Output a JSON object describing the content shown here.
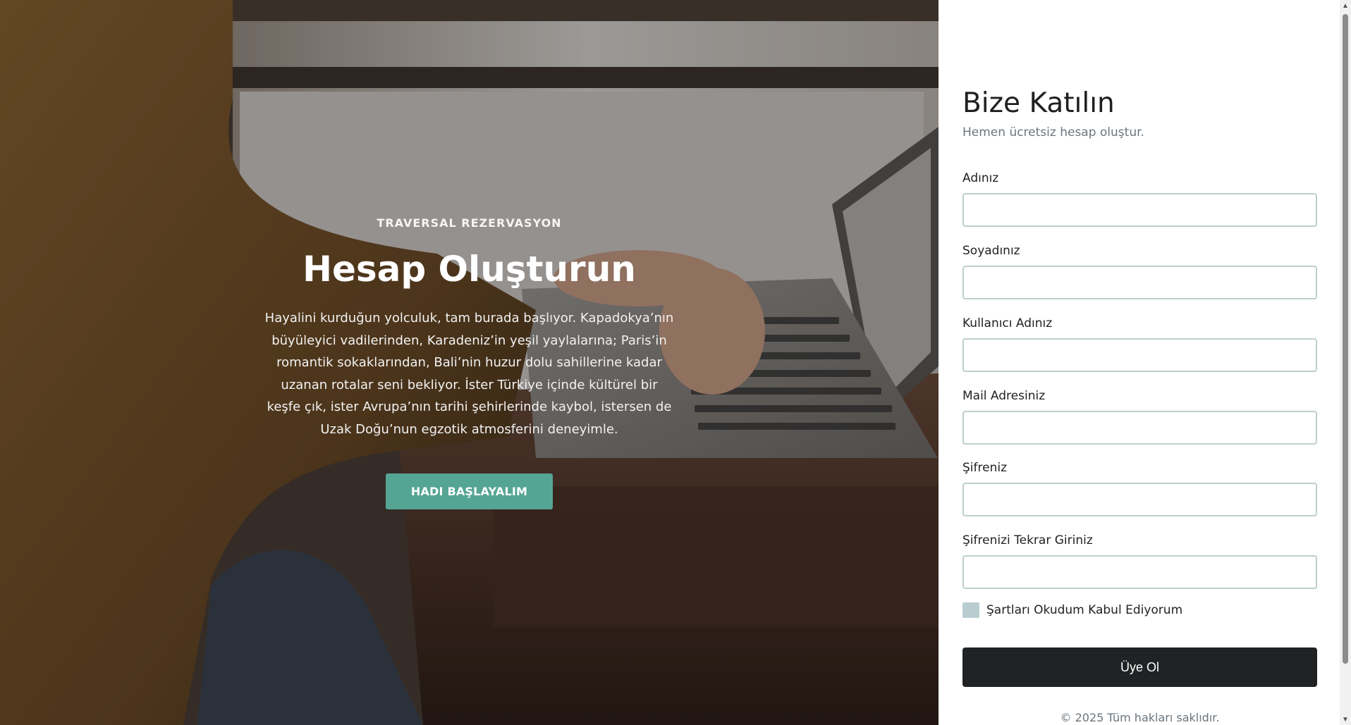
{
  "hero": {
    "eyebrow": "TRAVERSAL REZERVASYON",
    "title": "Hesap Oluşturun",
    "text": "Hayalini kurduğun yolculuk, tam burada başlıyor. Kapadokya’nın büyüleyici vadilerinden, Karadeniz’in yeşil yaylalarına; Paris’in romantik sokaklarından, Bali’nin huzur dolu sahillerine kadar uzanan rotalar seni bekliyor. İster Türkiye içinde kültürel bir keşfe çık, ister Avrupa’nın tarihi şehirlerinde kaybol, istersen de Uzak Doğu’nun egzotik atmosferini deneyimle.",
    "button_label": "HADI BAŞLAYALIM",
    "button_color": "#55a594"
  },
  "form": {
    "title": "Bize Katılın",
    "subtitle": "Hemen ücretsiz hesap oluştur.",
    "fields": [
      {
        "label": "Adınız",
        "value": ""
      },
      {
        "label": "Soyadınız",
        "value": ""
      },
      {
        "label": "Kullanıcı Adınız",
        "value": ""
      },
      {
        "label": "Mail Adresiniz",
        "value": ""
      },
      {
        "label": "Şifreniz",
        "value": ""
      },
      {
        "label": "Şifrenizi Tekrar Giriniz",
        "value": ""
      }
    ],
    "terms_label": "Şartları Okudum Kabul Ediyorum",
    "terms_checked": false,
    "submit_label": "Üye Ol",
    "footer": "© 2025 Tüm hakları saklıdır."
  }
}
